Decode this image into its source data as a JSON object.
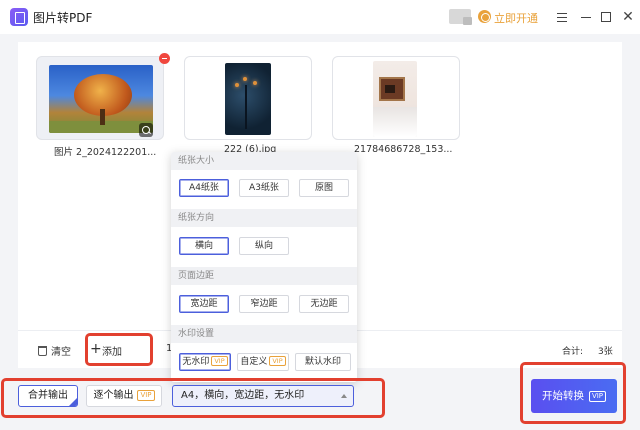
{
  "window": {
    "title": "图片转PDF",
    "vip_open_label": "立即开通",
    "close_glyph": "✕"
  },
  "files": [
    {
      "label": "图片 2_2024122201..."
    },
    {
      "label": "222 (6).jpg"
    },
    {
      "label": "21784686728_153..."
    }
  ],
  "toolbar": {
    "clear_label": "清空",
    "add_label": "添加",
    "cut_char": "1",
    "total_label": "合计:",
    "total_value": "3张"
  },
  "popup": {
    "paper_size": {
      "title": "纸张大小",
      "options": [
        "A4纸张",
        "A3纸张",
        "原图"
      ],
      "selected": "A4纸张"
    },
    "orientation": {
      "title": "纸张方向",
      "options": [
        "横向",
        "纵向"
      ],
      "selected": "横向"
    },
    "margin": {
      "title": "页面边距",
      "options": [
        "宽边距",
        "窄边距",
        "无边距"
      ],
      "selected": "宽边距"
    },
    "watermark": {
      "title": "水印设置",
      "options": [
        "无水印",
        "自定义",
        "默认水印"
      ],
      "selected": "无水印",
      "vip_badge": "VIP"
    }
  },
  "actions": {
    "merge_label": "合并输出",
    "single_label": "逐个输出",
    "vip_badge": "VIP",
    "settings_summary": "A4，横向，宽边距，无水印",
    "start_label": "开始转换"
  },
  "colors": {
    "accent": "#4c5fdc",
    "vip": "#e9a23b",
    "annotation": "#e2402f",
    "remove": "#f0473e"
  }
}
